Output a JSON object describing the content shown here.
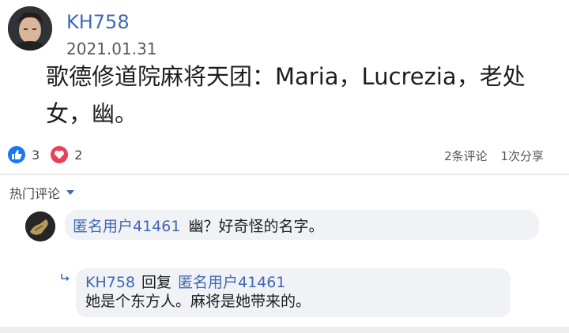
{
  "post": {
    "author": "KH758",
    "date": "2021.01.31",
    "text": "歌德修道院麻将天团：Maria，Lucrezia，老处女，幽。"
  },
  "reactions": {
    "like_count": "3",
    "love_count": "2",
    "like_icon": "thumbs-up-icon",
    "love_icon": "heart-icon"
  },
  "stats": {
    "comments": "2条评论",
    "shares": "1次分享"
  },
  "comments_header": {
    "sort_label": "热门评论"
  },
  "comment": {
    "author": "匿名用户41461",
    "text": "幽？好奇怪的名字。"
  },
  "reply": {
    "author": "KH758",
    "reply_word": "回复",
    "target": "匿名用户41461",
    "text": "她是个东方人。麻将是她带来的。"
  },
  "colors": {
    "link_blue": "#4267b2",
    "like_blue": "#1877f2",
    "love_red": "#e9415b",
    "bubble_bg": "#f0f2f5"
  }
}
